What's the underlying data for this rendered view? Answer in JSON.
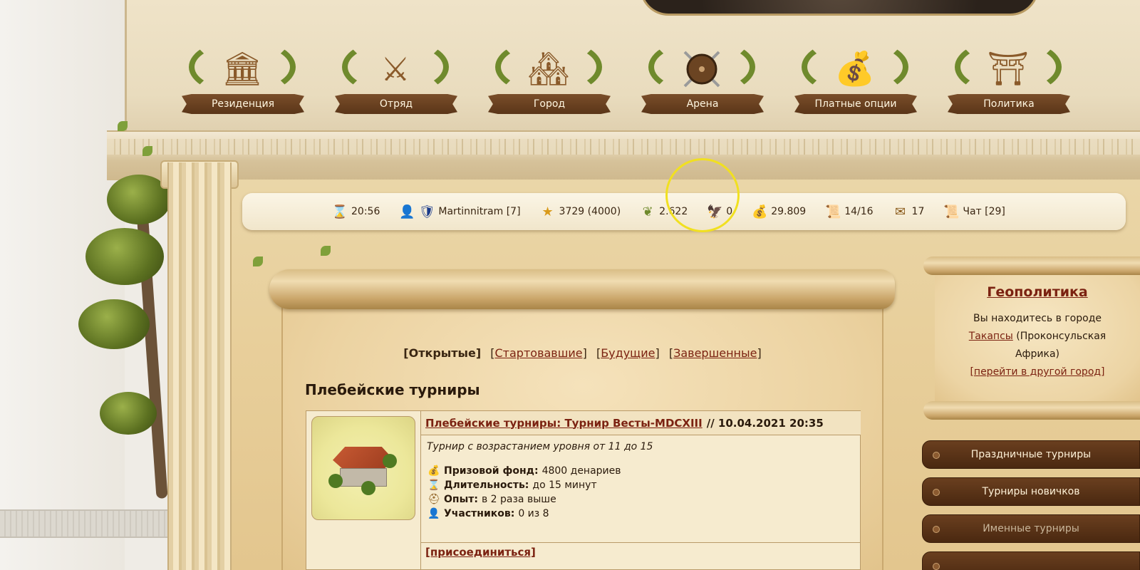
{
  "nav": [
    {
      "label": "Резиденция",
      "icon": "temple-icon"
    },
    {
      "label": "Отряд",
      "icon": "gladiators-icon"
    },
    {
      "label": "Город",
      "icon": "city-icon"
    },
    {
      "label": "Арена",
      "icon": "shield-swords-icon"
    },
    {
      "label": "Платные опции",
      "icon": "money-bag-icon"
    },
    {
      "label": "Политика",
      "icon": "triumphal-arch-icon"
    }
  ],
  "status": {
    "time": "20:56",
    "player": "Martinnitram [7]",
    "stars": "3729 (4000)",
    "laurel": "2.622",
    "eagles": "0",
    "gold": "29.809",
    "scrolls": "14/16",
    "mail": "17",
    "chat": "Чат [29]"
  },
  "tabs": {
    "open": "[Открытые]",
    "started": "Стартовавшие",
    "future": "Будущие",
    "finished": "Завершенные"
  },
  "section_title": "Плебейские турниры",
  "tournament": {
    "name": "Плебейские турниры: Турнир Весты-MDCXIII",
    "datetime": "// 10.04.2021 20:35",
    "description": "Турнир с возрастанием уровня от 11 до 15",
    "prize_label": "Призовой фонд:",
    "prize_value": "4800 денариев",
    "duration_label": "Длительность:",
    "duration_value": "до 15 минут",
    "exp_label": "Опыт:",
    "exp_value": "в 2 раза выше",
    "participants_label": "Участников:",
    "participants_value": "0 из 8",
    "join": "[присоединиться]"
  },
  "geo": {
    "title": "Геополитика",
    "line1": "Вы находитесь в городе",
    "city": "Такапсы",
    "region": "(Проконсульская",
    "region2": "Африка)",
    "change_city": "[перейти в другой город]"
  },
  "side_buttons": [
    "Праздничные турниры",
    "Турниры новичков",
    "Именные турниры"
  ],
  "colors": {
    "link": "#7b2211",
    "ribbon": "#5a3518",
    "highlight_ring": "#f1e020"
  }
}
